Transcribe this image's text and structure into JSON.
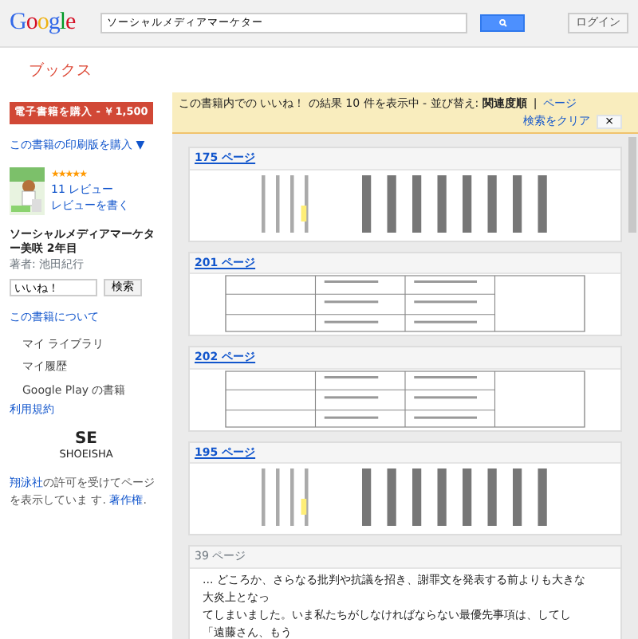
{
  "header": {
    "logo": "Google",
    "search": {
      "value": "ソーシャルメディアマーケター"
    },
    "login": "ログイン"
  },
  "section_title": "ブックス",
  "sidebar": {
    "buy_button": "電子書籍を購入 - ￥1,500",
    "print_link": "この書籍の印刷版を購入 ▼",
    "book": {
      "stars": 5,
      "reviews": "11 レビュー",
      "write_review": "レビューを書く",
      "title": "ソーシャルメディアマーケター美咲 2年目",
      "author": "著者: 池田紀行"
    },
    "search": {
      "value": "いいね！",
      "button": "検索"
    },
    "about_link": "この書籍について",
    "items": [
      {
        "label": "マイ ライブラリ"
      },
      {
        "label": "マイ履歴"
      },
      {
        "label": "Google Play の書籍"
      }
    ],
    "terms_link": "利用規約",
    "publisher_logo": "SE",
    "publisher_logo_sub": "SHOEISHA",
    "permission": {
      "publisher": "翔泳社",
      "text": "の許可を受けてページを表示していま す.",
      "copyright": "著作権",
      "end": "."
    }
  },
  "notice": {
    "text": "この書籍内での いいね！ の結果 10 件を表示中 - 並び替え: ",
    "sort_selected": "関連度順",
    "separator": "|",
    "sort_other": "ページ",
    "clear": "検索をクリア",
    "close": "×"
  },
  "results": [
    {
      "page": "175 ページ",
      "link": true,
      "kind": "vertical"
    },
    {
      "page": "201 ページ",
      "link": true,
      "kind": "table"
    },
    {
      "page": "202 ページ",
      "link": true,
      "kind": "table"
    },
    {
      "page": "195 ページ",
      "link": true,
      "kind": "vertical"
    },
    {
      "page": "39 ページ",
      "link": false,
      "kind": "snippet",
      "lines": [
        "... どころか、さらなる批判や抗議を招き、謝罪文を発表する前よりも大きな",
        "大炎上となっ",
        "てしまいました。いま私たちがしなければならない最優先事項は、してし",
        "「遠藤さん、もう"
      ]
    }
  ]
}
